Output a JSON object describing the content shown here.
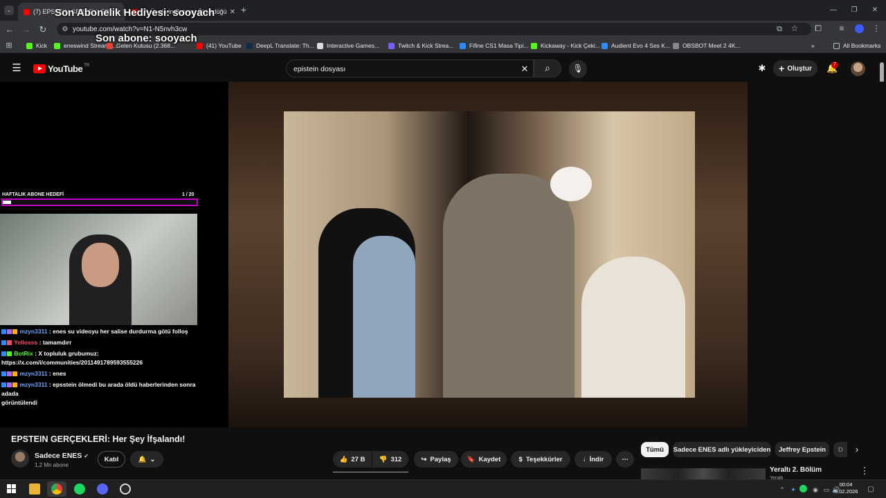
{
  "browser": {
    "tabs": [
      {
        "title": "(7) EPSTEIN GERÇEKLERİ: H"
      },
      {
        "title": "(7) Üyelerin Birbirini Öldürdüğü"
      }
    ],
    "new_tab": "+",
    "url": "youtube.com/watch?v=N1-N5nvh3cw",
    "bookmarks": [
      "Kick",
      "eneswind Stream -...",
      "Gelen Kutusu (2.368...",
      "(41) YouTube",
      "DeepL Translate: Th...",
      "Interactive Games...",
      "Twitch & Kick Strea...",
      "Fifine CS1 Masa Tipi...",
      "Kickaway - Kick Çeki...",
      "Audient Evo 4 Ses K...",
      "OBSBOT Meet 2 4K..."
    ],
    "all_bookmarks": "All Bookmarks"
  },
  "overlay": {
    "gift": "Son Abonelik Hediyesi: sooyach",
    "last_sub": "Son abone: sooyach",
    "goal_label": "HAFTALIK ABONE HEDEFİ",
    "goal_progress": "1 / 20",
    "goal_fraction": 0.05
  },
  "chat": [
    {
      "user": "mzyn3311",
      "color": "#6ea6ff",
      "text": ": enes su videoyu her salise durdurma götü folloş"
    },
    {
      "user": "Yellosss",
      "color": "#ff4d6a",
      "text": ": tamamdırr"
    },
    {
      "user": "BotRix",
      "color": "#53fc18",
      "text": ": X topluluk grubumuz:",
      "text2": "https://x.com/i/communities/2011491789593555226"
    },
    {
      "user": "mzyn3311",
      "color": "#6ea6ff",
      "text": ": enes"
    },
    {
      "user": "mzyn3311",
      "color": "#6ea6ff",
      "text": ": epsstein ölmedi bu arada öldü haberlerinden sonra adada",
      "text2": "görüntülendi"
    }
  ],
  "youtube": {
    "logo": "YouTube",
    "region": "TR",
    "search_value": "epistein dosyası",
    "create_label": "Oluştur",
    "notif_count": "7"
  },
  "video": {
    "title": "EPSTEIN GERÇEKLERİ: Her Şey İfşalandı!",
    "channel": "Sadece ENES",
    "subs": "1,2 Mn abone",
    "join": "Katıl",
    "likes": "27 B",
    "dislikes": "312",
    "share": "Paylaş",
    "save": "Kaydet",
    "thanks": "Teşekkürler",
    "download": "İndir"
  },
  "chips": [
    "Tümü",
    "Sadece ENES adlı yükleyiciden",
    "Jeffrey Epstein",
    "D"
  ],
  "recommended": {
    "title": "Yeraltı 2. Bölüm",
    "channel": "Yeraltı"
  },
  "taskbar": {
    "time": "00:04",
    "date": "5.02.2026"
  }
}
